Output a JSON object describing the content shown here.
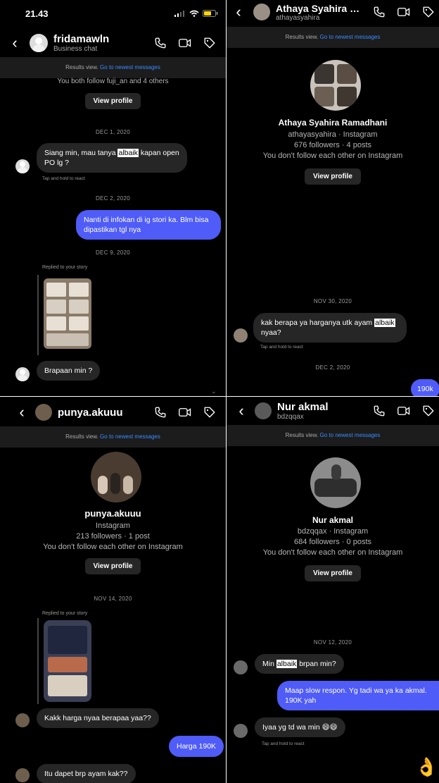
{
  "p1": {
    "status_time": "21.43",
    "name": "fridamawln",
    "sub": "Business chat",
    "banner_text": "Results view.",
    "banner_link": "Go to newest messages",
    "follow_text": "You both follow fuji_an and 4 others",
    "view_profile": "View profile",
    "date1": "DEC 1, 2020",
    "msg1_a": "Siang min, mau tanya ",
    "msg1_hl": "albaik",
    "msg1_b": " kapan open PO lg ?",
    "tap_hold": "Tap and hold to react",
    "date2": "DEC 2, 2020",
    "msg2": "Nanti di infokan di ig stori ka. Blm bisa dipastikan tgl nya",
    "date3": "DEC 9, 2020",
    "replied": "Replied to your story",
    "msg3": "Brapaan min ?"
  },
  "p2": {
    "name": "Athaya Syahira Ra...",
    "sub": "athayasyahira",
    "banner_text": "Results view.",
    "banner_link": "Go to newest messages",
    "profile_name": "Athaya Syahira Ramadhani",
    "profile_line1": "athayasyahira · Instagram",
    "profile_line2": "676 followers · 4 posts",
    "profile_line3": "You don't follow each other on Instagram",
    "view_profile": "View profile",
    "date1": "NOV 30, 2020",
    "msg1_a": "kak berapa ya harganya utk ayam ",
    "msg1_hl": "albaik",
    "msg1_b": " nyaa?",
    "tap_hold": "Tap and hold to react",
    "date2": "DEC 2, 2020",
    "msg2": "190k"
  },
  "p3": {
    "name": "punya.akuuu",
    "banner_text": "Results view.",
    "banner_link": "Go to newest messages",
    "profile_name": "punya.akuuu",
    "profile_line1": "Instagram",
    "profile_line2": "213 followers · 1 post",
    "profile_line3": "You don't follow each other on Instagram",
    "view_profile": "View profile",
    "date1": "NOV 14, 2020",
    "replied": "Replied to your story",
    "msg1": "Kakk harga nyaa berapaa yaa??",
    "msg2": "Harga 190K",
    "msg3": "Itu dapet brp ayam kak??"
  },
  "p4": {
    "name": "Nur akmal",
    "sub": "bdzqqax",
    "banner_text": "Results view.",
    "banner_link": "Go to newest messages",
    "profile_name": "Nur akmal",
    "profile_line1": "bdzqqax · Instagram",
    "profile_line2": "684 followers · 0 posts",
    "profile_line3": "You don't follow each other on Instagram",
    "view_profile": "View profile",
    "date1": "NOV 12, 2020",
    "msg1_a": "Min ",
    "msg1_hl": "albaik",
    "msg1_b": " brpan min?",
    "msg2": "Maap slow respon. Yg tadi wa ya ka akmal. 190K yah",
    "msg3": "Iyaa yg td wa min 😄😄",
    "tap_hold": "Tap and hold to react",
    "emoji": "👌"
  },
  "colors": {
    "background": "#000000",
    "incoming_bubble": "#262626",
    "outgoing_bubble": "#4f5cf7",
    "link": "#3a8cff"
  }
}
